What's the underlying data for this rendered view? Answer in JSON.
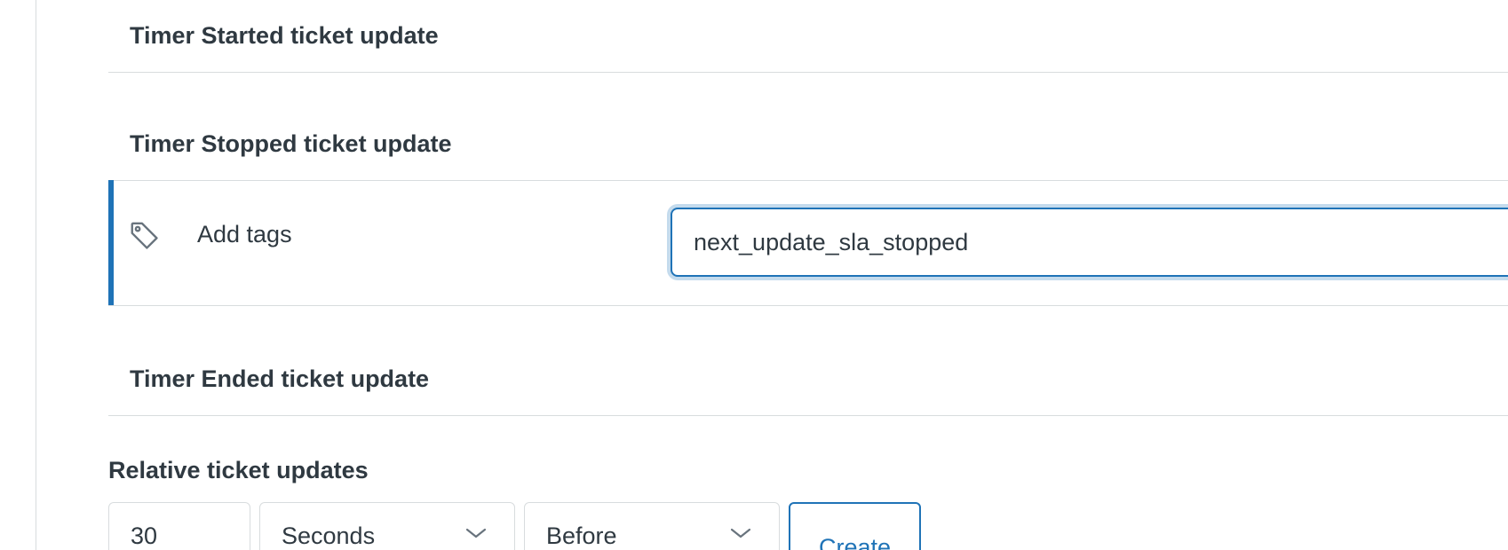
{
  "sections": {
    "timer_started": {
      "heading": "Timer Started ticket update"
    },
    "timer_stopped": {
      "heading": "Timer Stopped ticket update",
      "action": {
        "icon": "tag-icon",
        "label": "Add tags",
        "input_value": "next_update_sla_stopped"
      }
    },
    "timer_ended": {
      "heading": "Timer Ended ticket update"
    }
  },
  "relative_updates": {
    "heading": "Relative ticket updates",
    "amount_value": "30",
    "unit_selected": "Seconds",
    "direction_selected": "Before",
    "create_label": "Create",
    "chevron_icon": "chevron-down-icon"
  },
  "colors": {
    "accent": "#1f73b7",
    "text": "#2f3941",
    "border": "#d8dcde",
    "focus_ring": "#c4dbed"
  }
}
